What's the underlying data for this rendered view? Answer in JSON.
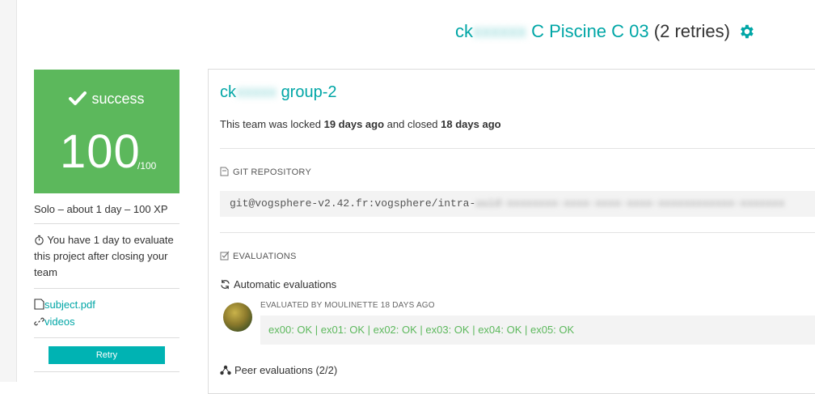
{
  "header": {
    "user_prefix": "ck",
    "user_hidden": "xxxxxx",
    "project": "C Piscine C 03",
    "retries": "(2 retries)",
    "accent": "#00a6a6"
  },
  "score": {
    "status": "success",
    "value": "100",
    "max": "/100",
    "color": "#5cb85c"
  },
  "sidebar": {
    "summary": "Solo – about 1 day – 100 XP",
    "eval_note": "You have 1 day to evaluate this project after closing your team",
    "subject_link": "subject.pdf",
    "videos_link": "videos",
    "retry_label": "Retry"
  },
  "team": {
    "name_prefix": "ck",
    "name_hidden": "xxxxx",
    "name_suffix": "group-2",
    "locked_pre": "This team was locked ",
    "locked_ago": "19 days ago",
    "closed_pre": " and closed ",
    "closed_ago": "18 days ago"
  },
  "repository": {
    "heading": "GIT REPOSITORY",
    "url": "git@vogsphere-v2.42.fr:vogsphere/intra-",
    "url_hidden": "uuid-xxxxxxxx-xxxx-xxxx-xxxx-xxxxxxxxxxxx-xxxxxxx"
  },
  "evaluations": {
    "heading": "EVALUATIONS",
    "automatic_heading": "Automatic evaluations",
    "evaluated_by": "EVALUATED BY MOULINETTE 18 DAYS AGO",
    "result": "ex00: OK | ex01: OK | ex02: OK | ex03: OK | ex04: OK | ex05: OK",
    "peer_heading": "Peer evaluations (2/2)"
  }
}
